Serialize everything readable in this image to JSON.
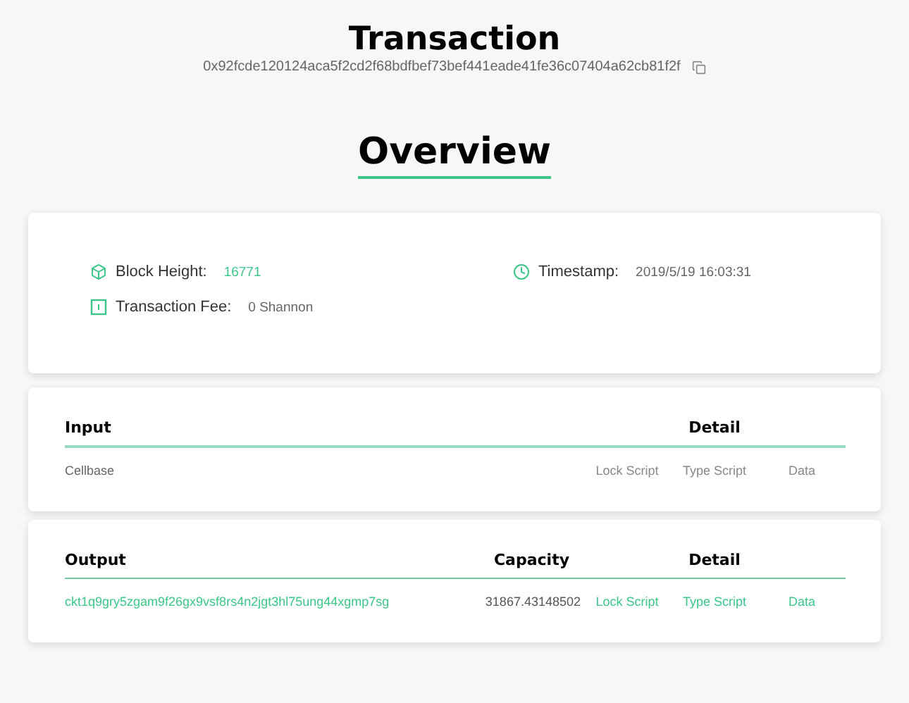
{
  "title": "Transaction",
  "hash": "0x92fcde120124aca5f2cd2f68bdfbef73bef441eade41fe36c07404a62cb81f2f",
  "overview": {
    "heading": "Overview",
    "items": [
      {
        "label": "Block Height:",
        "value": "16771",
        "kind": "link"
      },
      {
        "label": "Timestamp:",
        "value": "2019/5/19 16:03:31",
        "kind": "plain"
      },
      {
        "label": "Transaction Fee:",
        "value": "0 Shannon",
        "kind": "plain"
      }
    ]
  },
  "sections": [
    {
      "heading": "Input",
      "detail_heading": "Detail",
      "rows": [
        {
          "address": "Cellbase",
          "kind": "cellbase",
          "links": [
            {
              "label": "Lock Script",
              "disabled": true
            },
            {
              "label": "Type Script",
              "disabled": true
            },
            {
              "label": "Data",
              "disabled": true
            }
          ]
        }
      ]
    },
    {
      "heading": "Output",
      "capacity_heading": "Capacity",
      "detail_heading": "Detail",
      "rows": [
        {
          "address": "ckt1q9gry5zgam9f26gx9vsf8rs4n2jgt3hl75ung44xgmp7sg",
          "kind": "address",
          "capacity": "31867.43148502",
          "links": [
            {
              "label": "Lock Script",
              "disabled": false
            },
            {
              "label": "Type Script",
              "disabled": false
            },
            {
              "label": "Data",
              "disabled": false
            }
          ]
        }
      ]
    }
  ]
}
